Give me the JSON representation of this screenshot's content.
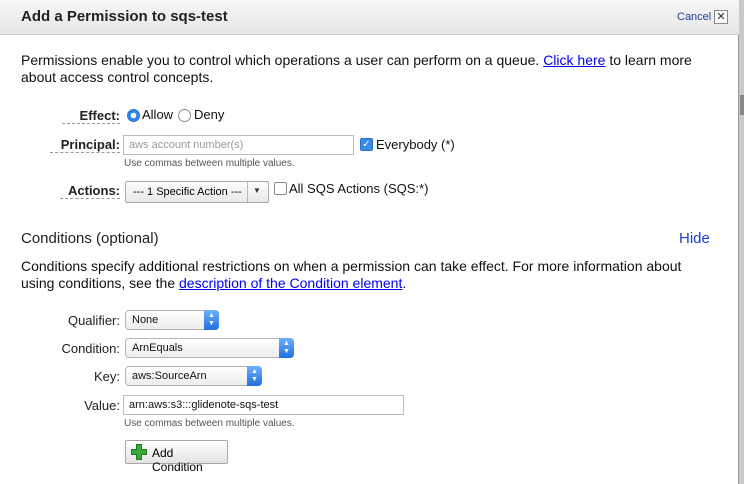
{
  "dialog": {
    "title": "Add a Permission to sqs-test",
    "cancel_label": "Cancel",
    "close_glyph": "✕"
  },
  "intro": {
    "text_before": "Permissions enable you to control which operations a user can perform on a queue. ",
    "link": "Click here",
    "text_after": " to learn more about access control concepts."
  },
  "effect": {
    "label": "Effect:",
    "options": [
      "Allow",
      "Deny"
    ],
    "selected": "Allow"
  },
  "principal": {
    "label": "Principal:",
    "value": "",
    "placeholder": "aws account number(s)",
    "everybody_label": "Everybody (*)",
    "everybody_checked": true,
    "hint": "Use commas between multiple values."
  },
  "actions": {
    "label": "Actions:",
    "selected": "--- 1 Specific Action ---",
    "all_label": "All SQS Actions (SQS:*)",
    "all_checked": false
  },
  "conditions": {
    "title": "Conditions (optional)",
    "hide_label": "Hide",
    "text_before": "Conditions specify additional restrictions on when a permission can take effect. For more information about using conditions, see the ",
    "link": "description of the Condition element",
    "text_after": ".",
    "qualifier_label": "Qualifier:",
    "qualifier_value": "None",
    "condition_label": "Condition:",
    "condition_value": "ArnEquals",
    "key_label": "Key:",
    "key_value": "aws:SourceArn",
    "value_label": "Value:",
    "value_value": "arn:aws:s3:::glidenote-sqs-test",
    "value_hint": "Use commas between multiple values.",
    "add_button": "Add Condition"
  },
  "icons": {
    "close": "close-icon",
    "radio": "radio-icon",
    "checkbox": "checkbox-icon",
    "dropdown": "chevron-down-icon",
    "stepper": "select-stepper-icon",
    "add": "green-plus-icon"
  },
  "colors": {
    "link": "#0000ee",
    "accent_blue": "#2f82e6",
    "plus_green": "#3aa83a"
  }
}
